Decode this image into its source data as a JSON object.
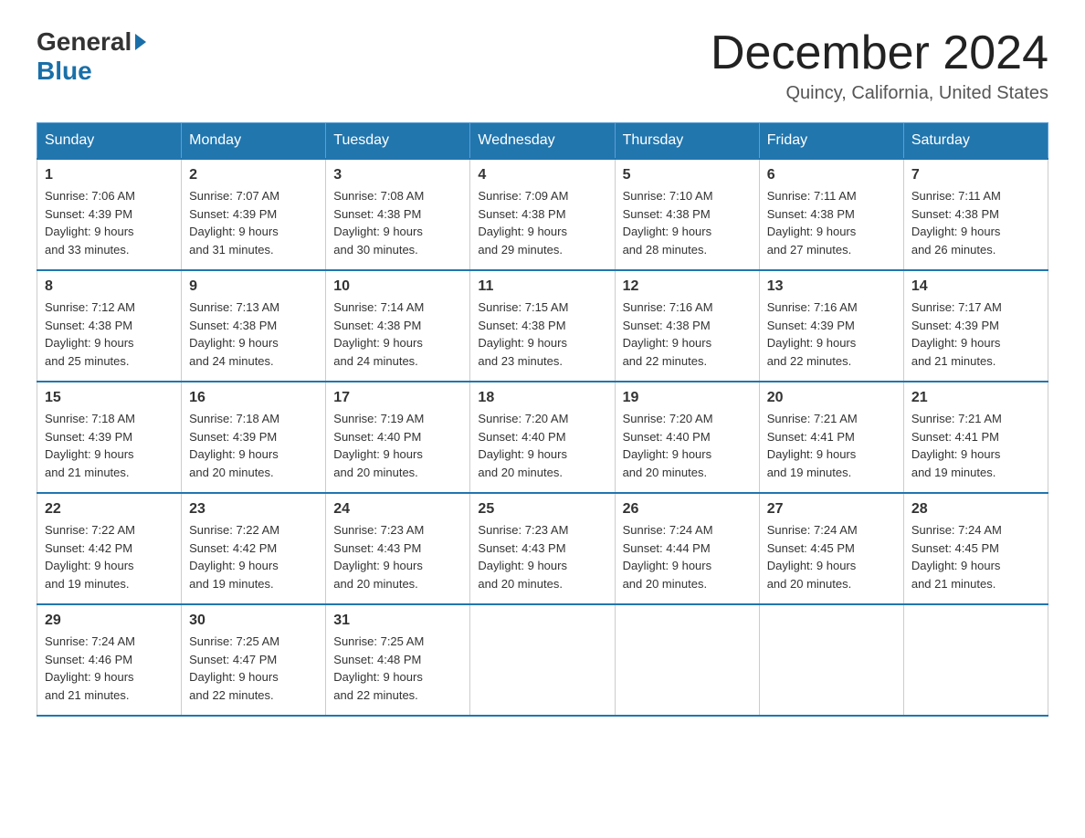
{
  "logo": {
    "general": "General",
    "blue": "Blue"
  },
  "header": {
    "title": "December 2024",
    "location": "Quincy, California, United States"
  },
  "weekdays": [
    "Sunday",
    "Monday",
    "Tuesday",
    "Wednesday",
    "Thursday",
    "Friday",
    "Saturday"
  ],
  "weeks": [
    [
      {
        "day": "1",
        "sunrise": "7:06 AM",
        "sunset": "4:39 PM",
        "daylight": "9 hours and 33 minutes."
      },
      {
        "day": "2",
        "sunrise": "7:07 AM",
        "sunset": "4:39 PM",
        "daylight": "9 hours and 31 minutes."
      },
      {
        "day": "3",
        "sunrise": "7:08 AM",
        "sunset": "4:38 PM",
        "daylight": "9 hours and 30 minutes."
      },
      {
        "day": "4",
        "sunrise": "7:09 AM",
        "sunset": "4:38 PM",
        "daylight": "9 hours and 29 minutes."
      },
      {
        "day": "5",
        "sunrise": "7:10 AM",
        "sunset": "4:38 PM",
        "daylight": "9 hours and 28 minutes."
      },
      {
        "day": "6",
        "sunrise": "7:11 AM",
        "sunset": "4:38 PM",
        "daylight": "9 hours and 27 minutes."
      },
      {
        "day": "7",
        "sunrise": "7:11 AM",
        "sunset": "4:38 PM",
        "daylight": "9 hours and 26 minutes."
      }
    ],
    [
      {
        "day": "8",
        "sunrise": "7:12 AM",
        "sunset": "4:38 PM",
        "daylight": "9 hours and 25 minutes."
      },
      {
        "day": "9",
        "sunrise": "7:13 AM",
        "sunset": "4:38 PM",
        "daylight": "9 hours and 24 minutes."
      },
      {
        "day": "10",
        "sunrise": "7:14 AM",
        "sunset": "4:38 PM",
        "daylight": "9 hours and 24 minutes."
      },
      {
        "day": "11",
        "sunrise": "7:15 AM",
        "sunset": "4:38 PM",
        "daylight": "9 hours and 23 minutes."
      },
      {
        "day": "12",
        "sunrise": "7:16 AM",
        "sunset": "4:38 PM",
        "daylight": "9 hours and 22 minutes."
      },
      {
        "day": "13",
        "sunrise": "7:16 AM",
        "sunset": "4:39 PM",
        "daylight": "9 hours and 22 minutes."
      },
      {
        "day": "14",
        "sunrise": "7:17 AM",
        "sunset": "4:39 PM",
        "daylight": "9 hours and 21 minutes."
      }
    ],
    [
      {
        "day": "15",
        "sunrise": "7:18 AM",
        "sunset": "4:39 PM",
        "daylight": "9 hours and 21 minutes."
      },
      {
        "day": "16",
        "sunrise": "7:18 AM",
        "sunset": "4:39 PM",
        "daylight": "9 hours and 20 minutes."
      },
      {
        "day": "17",
        "sunrise": "7:19 AM",
        "sunset": "4:40 PM",
        "daylight": "9 hours and 20 minutes."
      },
      {
        "day": "18",
        "sunrise": "7:20 AM",
        "sunset": "4:40 PM",
        "daylight": "9 hours and 20 minutes."
      },
      {
        "day": "19",
        "sunrise": "7:20 AM",
        "sunset": "4:40 PM",
        "daylight": "9 hours and 20 minutes."
      },
      {
        "day": "20",
        "sunrise": "7:21 AM",
        "sunset": "4:41 PM",
        "daylight": "9 hours and 19 minutes."
      },
      {
        "day": "21",
        "sunrise": "7:21 AM",
        "sunset": "4:41 PM",
        "daylight": "9 hours and 19 minutes."
      }
    ],
    [
      {
        "day": "22",
        "sunrise": "7:22 AM",
        "sunset": "4:42 PM",
        "daylight": "9 hours and 19 minutes."
      },
      {
        "day": "23",
        "sunrise": "7:22 AM",
        "sunset": "4:42 PM",
        "daylight": "9 hours and 19 minutes."
      },
      {
        "day": "24",
        "sunrise": "7:23 AM",
        "sunset": "4:43 PM",
        "daylight": "9 hours and 20 minutes."
      },
      {
        "day": "25",
        "sunrise": "7:23 AM",
        "sunset": "4:43 PM",
        "daylight": "9 hours and 20 minutes."
      },
      {
        "day": "26",
        "sunrise": "7:24 AM",
        "sunset": "4:44 PM",
        "daylight": "9 hours and 20 minutes."
      },
      {
        "day": "27",
        "sunrise": "7:24 AM",
        "sunset": "4:45 PM",
        "daylight": "9 hours and 20 minutes."
      },
      {
        "day": "28",
        "sunrise": "7:24 AM",
        "sunset": "4:45 PM",
        "daylight": "9 hours and 21 minutes."
      }
    ],
    [
      {
        "day": "29",
        "sunrise": "7:24 AM",
        "sunset": "4:46 PM",
        "daylight": "9 hours and 21 minutes."
      },
      {
        "day": "30",
        "sunrise": "7:25 AM",
        "sunset": "4:47 PM",
        "daylight": "9 hours and 22 minutes."
      },
      {
        "day": "31",
        "sunrise": "7:25 AM",
        "sunset": "4:48 PM",
        "daylight": "9 hours and 22 minutes."
      },
      null,
      null,
      null,
      null
    ]
  ],
  "labels": {
    "sunrise": "Sunrise:",
    "sunset": "Sunset:",
    "daylight": "Daylight:"
  }
}
